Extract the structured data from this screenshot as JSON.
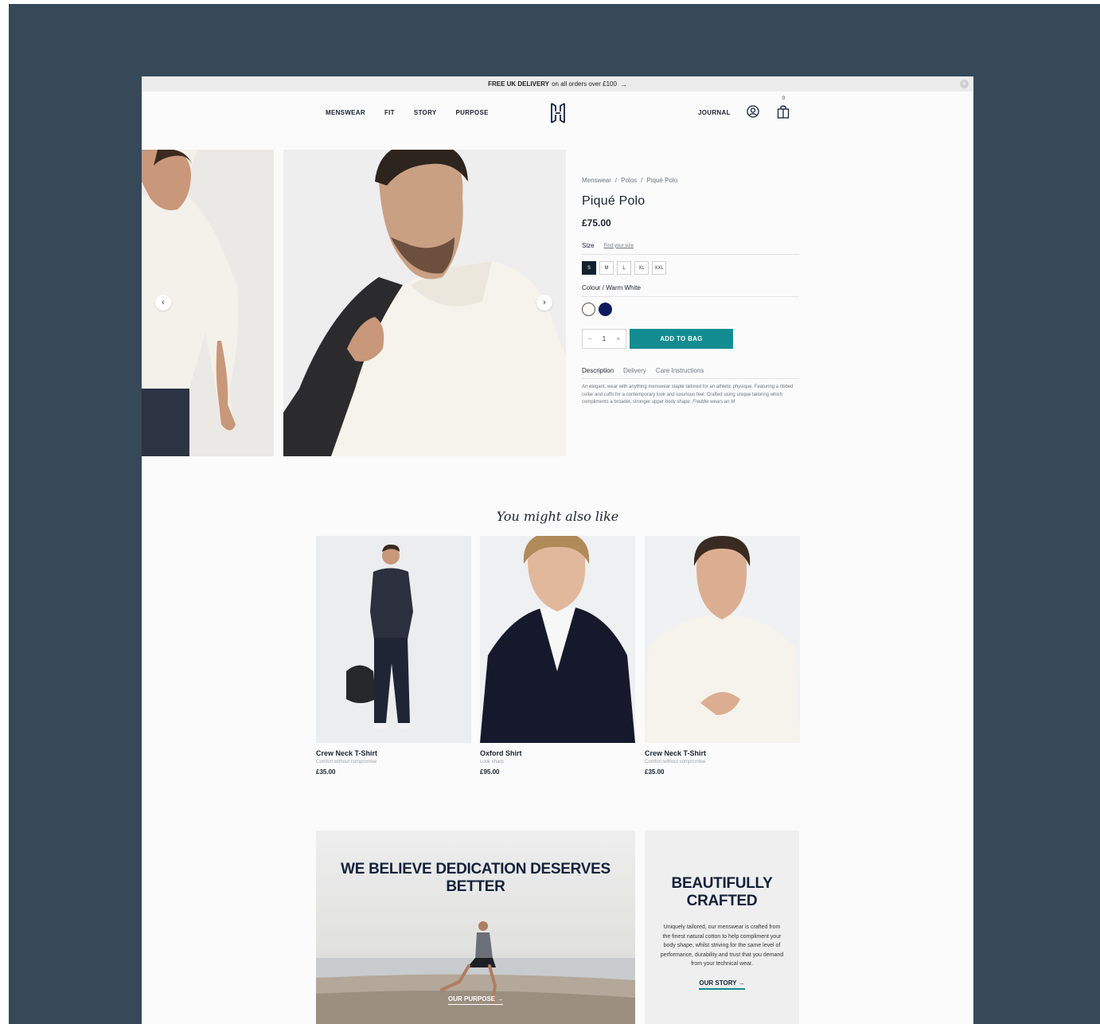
{
  "promo": {
    "bold": "FREE UK DELIVERY",
    "text": "on all orders over £100",
    "arrow": "→",
    "close": "×"
  },
  "nav": {
    "items": [
      "MENSWEAR",
      "FIT",
      "STORY",
      "PURPOSE"
    ],
    "journal": "JOURNAL",
    "bag_count": "0"
  },
  "product": {
    "breadcrumb": [
      "Menswear",
      "/",
      "Polos",
      "/",
      "Piqué Polo"
    ],
    "title": "Piqué Polo",
    "price": "£75.00",
    "size_label": "Size",
    "find_size": "Find your size",
    "sizes": [
      "S",
      "M",
      "L",
      "XL",
      "XXL"
    ],
    "selected_size": "S",
    "colour_label": "Colour / Warm White",
    "colours": [
      "#fbfaf5",
      "#0f1a5c"
    ],
    "qty_minus": "−",
    "qty_value": "1",
    "qty_plus": "+",
    "add_to_bag": "ADD TO BAG",
    "tabs": [
      "Description",
      "Delivery",
      "Care Instructions"
    ],
    "description": "An elegant, wear with anything menswear staple tailored for an athletic physique. Featuring a ribbed collar and cuffs for a contemporary look and luxurious feel. Crafted using unique tailoring which compliments a broader, stronger upper body shape.",
    "description_note": "Freddie wears an M"
  },
  "carousel": {
    "prev": "‹",
    "next": "›"
  },
  "recommendations": {
    "title": "You might also like",
    "items": [
      {
        "name": "Crew Neck T-Shirt",
        "tagline": "Comfort without compromise",
        "price": "£35.00"
      },
      {
        "name": "Oxford Shirt",
        "tagline": "Look sharp",
        "price": "£95.00"
      },
      {
        "name": "Crew Neck T-Shirt",
        "tagline": "Comfort without compromise",
        "price": "£35.00"
      }
    ]
  },
  "banner": {
    "title_line1": "WE BELIEVE DEDICATION DESERVES",
    "title_line2": "BETTER",
    "link": "OUR PURPOSE →"
  },
  "crafted": {
    "title_line1": "BEAUTIFULLY",
    "title_line2": "CRAFTED",
    "text": "Uniquely tailored, our menswear is crafted from the finest natural cotton to help compliment your body shape, whilst striving for the same level of performance, durability and trust that you demand from your technical wear.",
    "link": "OUR STORY →"
  },
  "colors": {
    "backdrop": "#354958",
    "accent": "#138c91",
    "navy": "#13213a"
  }
}
